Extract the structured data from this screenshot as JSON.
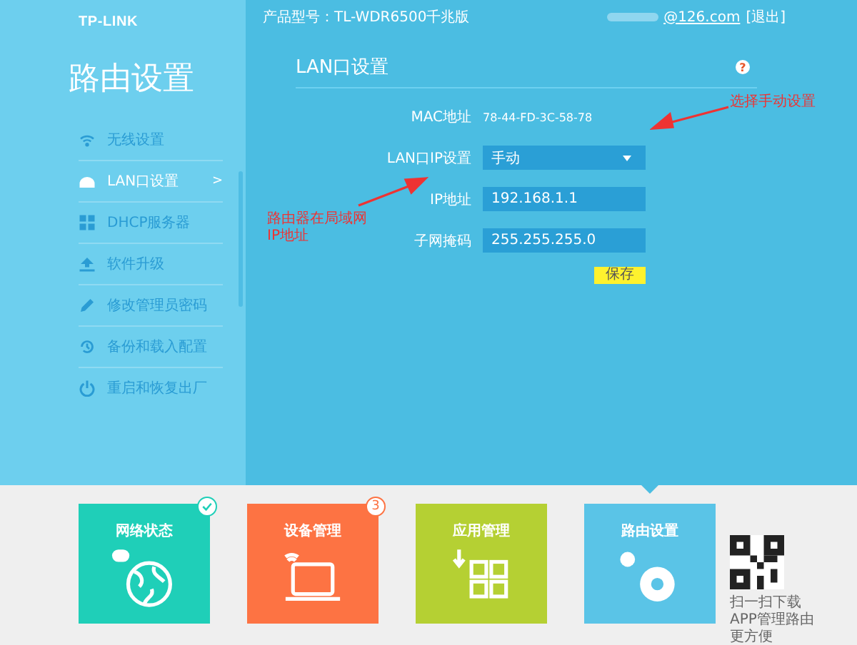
{
  "header": {
    "logo": "TP-LINK",
    "product": "产品型号：TL-WDR6500千兆版",
    "account": "@126.com",
    "logout": "[退出]"
  },
  "sidebar": {
    "title": "路由设置",
    "items": [
      {
        "label": "无线设置",
        "selected": false
      },
      {
        "label": "LAN口设置",
        "selected": true,
        "arrow": ">"
      },
      {
        "label": "DHCP服务器",
        "selected": false
      },
      {
        "label": "软件升级",
        "selected": false
      },
      {
        "label": "修改管理员密码",
        "selected": false
      },
      {
        "label": "备份和载入配置",
        "selected": false
      },
      {
        "label": "重启和恢复出厂",
        "selected": false
      }
    ]
  },
  "panel": {
    "title": "LAN口设置",
    "help": "?",
    "fields": [
      {
        "kind": "text",
        "label": "MAC地址",
        "value": "78-44-FD-3C-58-78"
      },
      {
        "kind": "select",
        "label": "LAN口IP设置",
        "value": "手动"
      },
      {
        "kind": "input",
        "label": "IP地址",
        "value": "192.168.1.1"
      },
      {
        "kind": "input",
        "label": "子网掩码",
        "value": "255.255.255.0"
      }
    ],
    "save": "保存"
  },
  "annotations": [
    {
      "text": "选择手动设置"
    },
    {
      "text": "路由器在局域网\nIP地址"
    }
  ],
  "tiles": [
    {
      "label": "网络状态",
      "color": "#1fcfb8",
      "selected": false,
      "kind": "check"
    },
    {
      "label": "设备管理",
      "color": "#fd7343",
      "selected": false,
      "kind": "count",
      "badge": "3"
    },
    {
      "label": "应用管理",
      "color": "#b5d033",
      "selected": false
    },
    {
      "label": "路由设置",
      "color": "#5ac4e7",
      "selected": true
    }
  ],
  "qr": {
    "lines": [
      "扫一扫下载",
      "APP管理路由",
      "更方便"
    ]
  }
}
